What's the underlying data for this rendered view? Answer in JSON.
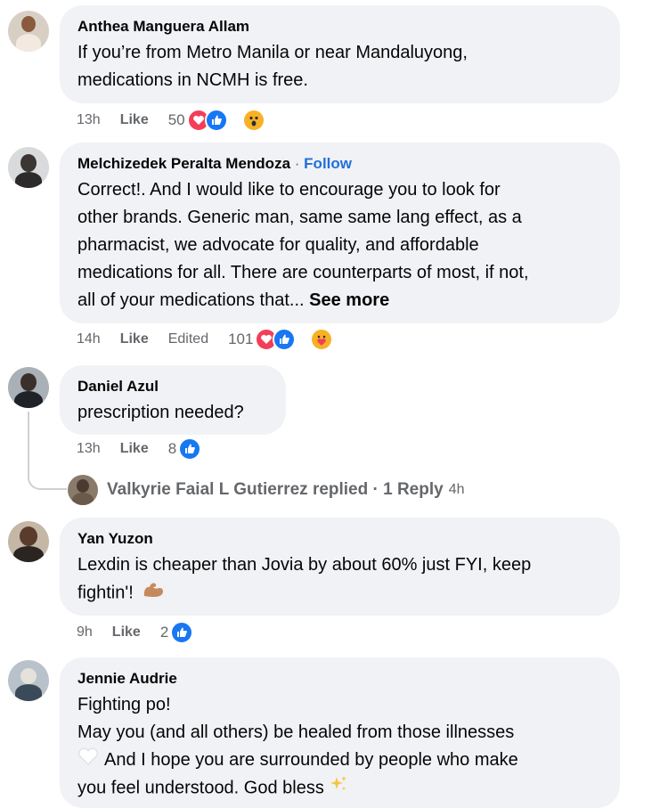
{
  "comments": [
    {
      "author": "Anthea Manguera Allam",
      "lines": [
        "If you’re from Metro Manila or near Mandaluyong,",
        "medications in NCMH is free."
      ],
      "time": "13h",
      "like": "Like",
      "count": "50"
    },
    {
      "author": "Melchizedek Peralta Mendoza",
      "follow": "Follow",
      "lines": [
        "Correct!. And I would like to encourage you to look for",
        "other brands. Generic man, same same lang effect, as a",
        "pharmacist, we advocate for quality, and affordable",
        "medications for all. There are counterparts of most, if not,",
        "all of your medications that..."
      ],
      "see_more": "See more",
      "time": "14h",
      "like": "Like",
      "edited": "Edited",
      "count": "101"
    },
    {
      "author": "Daniel Azul",
      "lines": [
        "prescription needed?"
      ],
      "time": "13h",
      "like": "Like",
      "count": "8",
      "reply_summary": {
        "name": "Valkyrie Faial L Gutierrez",
        "text": "replied · 1 Reply",
        "time": "4h"
      }
    },
    {
      "author": "Yan Yuzon",
      "lines": [
        "Lexdin is cheaper than Jovia by about 60% just FYI, keep",
        "fightin'!"
      ],
      "time": "9h",
      "like": "Like",
      "count": "2"
    },
    {
      "author": "Jennie Audrie",
      "lines": [
        "Fighting po!",
        "May you (and all others) be healed from those illnesses",
        "And I hope you are surrounded by people who make",
        "you feel understood. God bless"
      ]
    }
  ],
  "colors": {
    "bubble": "#f0f2f5",
    "follow": "#216fdb",
    "meta": "#65676b",
    "love": "#f33e58",
    "like": "#1877f2",
    "haha_wow": "#f7b125"
  }
}
